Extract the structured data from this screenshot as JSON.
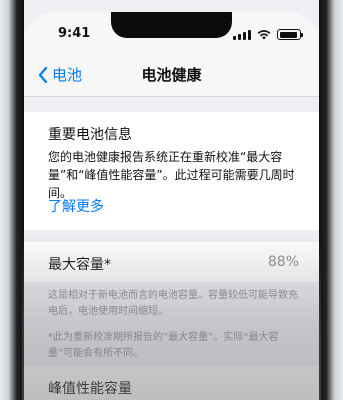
{
  "status": {
    "time": "9:41"
  },
  "nav": {
    "back_label": "电池",
    "title": "电池健康"
  },
  "notice": {
    "title": "重要电池信息",
    "body": "您的电池健康报告系统正在重新校准“最大容量”和“峰值性能容量”。此过程可能需要几周时间。",
    "link": "了解更多"
  },
  "max_capacity": {
    "label": "最大容量*",
    "value": "88%",
    "footnote1": "这是相对于新电池而言的电池容量。容量较低可能导致充电后，电池使用时间缩短。",
    "footnote2": "*此为重新校准期所报告的“最大容量”。实际“最大容量”可能会有所不同。"
  },
  "peak": {
    "label": "峰值性能容量"
  }
}
